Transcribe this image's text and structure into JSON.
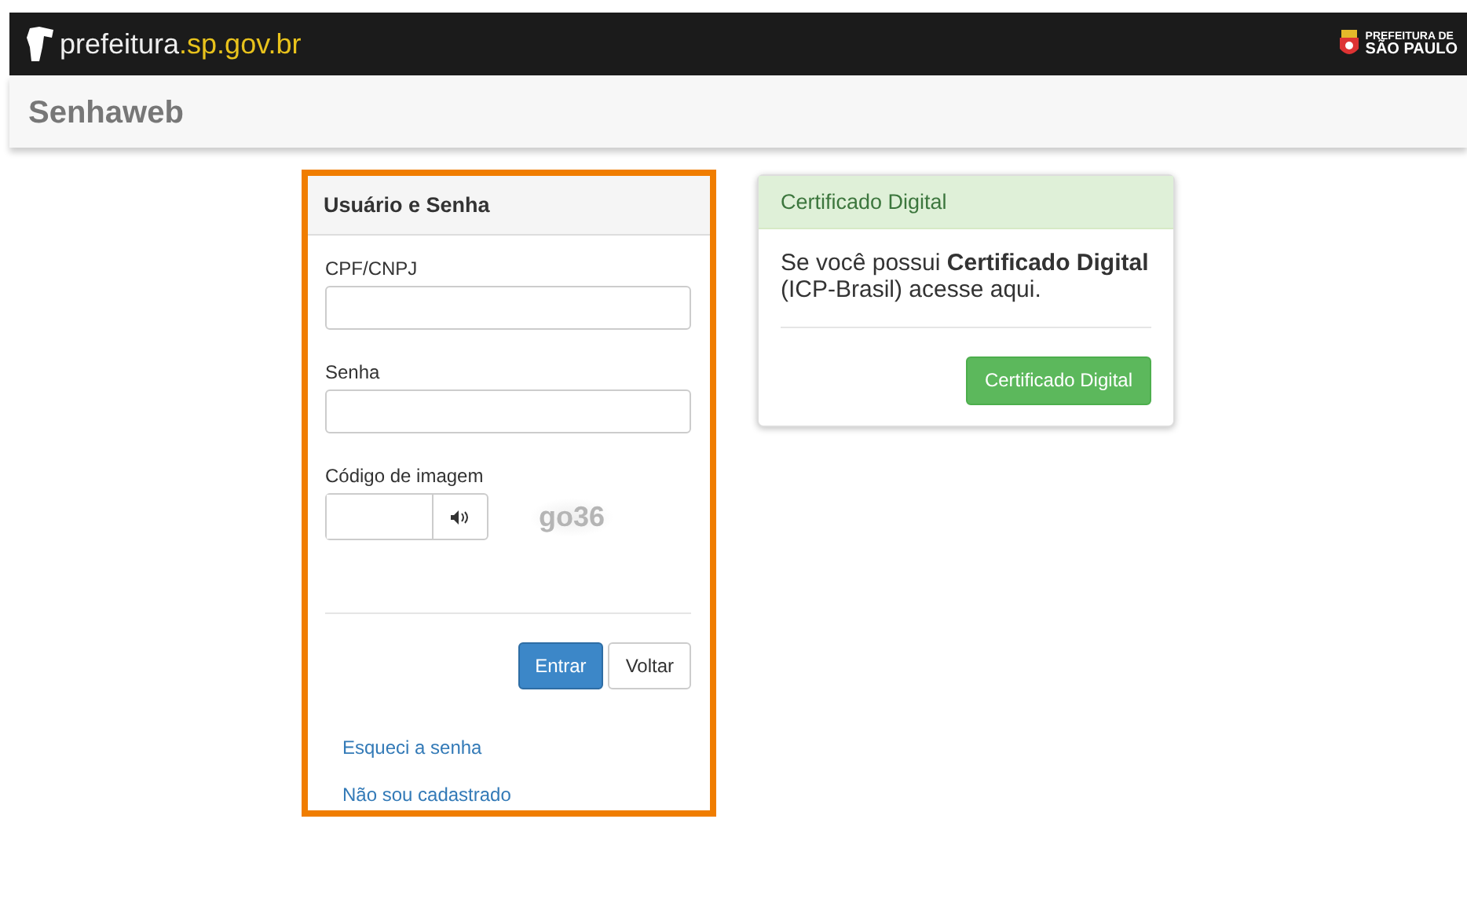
{
  "topbar": {
    "site_name": "prefeitura",
    "site_domain": ".sp.gov.br",
    "brand_line1": "PREFEITURA DE",
    "brand_line2": "SÃO PAULO"
  },
  "header": {
    "title": "Senhaweb"
  },
  "login": {
    "title": "Usuário e Senha",
    "fields": [
      {
        "label": "CPF/CNPJ"
      },
      {
        "label": "Senha"
      }
    ],
    "captcha_label": "Código de imagem",
    "captcha_text": "go36",
    "buttons": [
      {
        "label": "Entrar",
        "kind": "primary"
      },
      {
        "label": "Voltar",
        "kind": "default"
      }
    ],
    "links": [
      "Esqueci a senha",
      "Não sou cadastrado"
    ]
  },
  "certificate": {
    "title": "Certificado Digital",
    "text": "Se você possui **Certificado Digital** (ICP-Brasil) acesse aqui.",
    "button": "Certificado Digital"
  }
}
